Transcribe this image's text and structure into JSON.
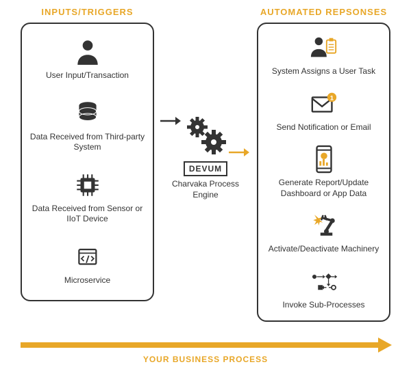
{
  "left": {
    "title": "INPUTS/TRIGGERS",
    "items": [
      {
        "icon": "user-icon",
        "label": "User Input/Transaction"
      },
      {
        "icon": "database-icon",
        "label": "Data Received from Third-party System"
      },
      {
        "icon": "chip-icon",
        "label": "Data Received from Sensor or IIoT Device"
      },
      {
        "icon": "code-icon",
        "label": "Microservice"
      }
    ]
  },
  "middle": {
    "logo": "DEVUM",
    "label": "Charvaka Process Engine"
  },
  "right": {
    "title": "AUTOMATED REPSONSES",
    "items": [
      {
        "icon": "user-task-icon",
        "label": "System Assigns a User Task"
      },
      {
        "icon": "envelope-badge-icon",
        "label": "Send Notification or Email"
      },
      {
        "icon": "phone-report-icon",
        "label": "Generate Report/Update Dashboard or App Data"
      },
      {
        "icon": "robot-arm-icon",
        "label": "Activate/Deactivate Machinery"
      },
      {
        "icon": "subprocess-icon",
        "label": "Invoke Sub-Processes"
      }
    ]
  },
  "bottom_caption": "YOUR BUSINESS PROCESS",
  "colors": {
    "accent": "#e8a728",
    "stroke": "#333333"
  }
}
